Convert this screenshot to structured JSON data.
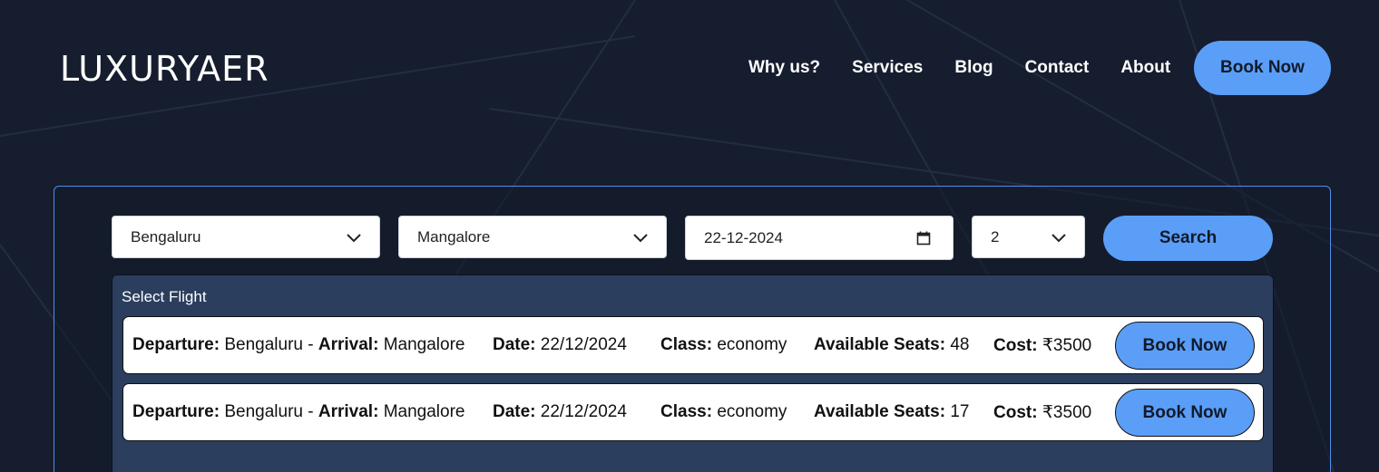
{
  "brand": {
    "logo_text": "LUXURYAER"
  },
  "nav": {
    "items": [
      {
        "label": "Why us?"
      },
      {
        "label": "Services"
      },
      {
        "label": "Blog"
      },
      {
        "label": "Contact"
      },
      {
        "label": "About"
      }
    ],
    "book_now_label": "Book Now"
  },
  "search": {
    "from_value": "Bengaluru",
    "to_value": "Mangalore",
    "date_value": "22-12-2024",
    "passengers_value": "2",
    "search_label": "Search"
  },
  "results": {
    "title": "Select Flight",
    "labels": {
      "departure": "Departure:",
      "arrival": "Arrival:",
      "date": "Date:",
      "class": "Class:",
      "seats": "Available Seats:",
      "cost": "Cost:",
      "separator": "-"
    },
    "flights": [
      {
        "departure": "Bengaluru",
        "arrival": "Mangalore",
        "date": "22/12/2024",
        "class": "economy",
        "seats": "48",
        "cost": "₹3500",
        "book_label": "Book Now"
      },
      {
        "departure": "Bengaluru",
        "arrival": "Mangalore",
        "date": "22/12/2024",
        "class": "economy",
        "seats": "17",
        "cost": "₹3500",
        "book_label": "Book Now"
      }
    ]
  },
  "colors": {
    "background": "#161d2e",
    "accent": "#5b9ef7",
    "panel_border": "#4d8ee9",
    "results_bg": "#2b3e5e"
  }
}
